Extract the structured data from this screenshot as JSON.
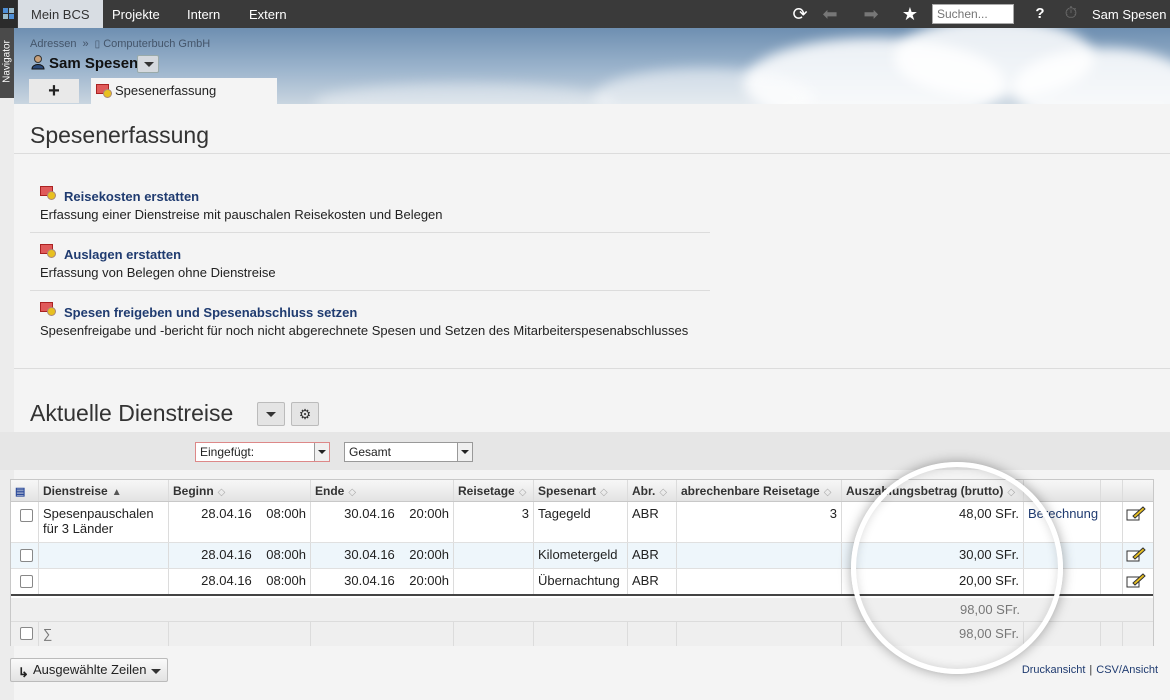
{
  "topnav": {
    "tabs": [
      "Mein BCS",
      "Projekte",
      "Intern",
      "Extern"
    ],
    "search_placeholder": "Suchen...",
    "help_label": "?",
    "user": "Sam Spesen"
  },
  "navigator_label": "Navigator",
  "breadcrumb": {
    "level1": "Adressen",
    "separator": "»",
    "level2": "Computerbuch GmbH"
  },
  "person": {
    "name": "Sam Spesen"
  },
  "tabs": {
    "add_label": "+",
    "current": "Spesenerfassung"
  },
  "page_title": "Spesenerfassung",
  "actions": [
    {
      "title": "Reisekosten erstatten",
      "desc": "Erfassung einer Dienstreise mit pauschalen Reisekosten und Belegen"
    },
    {
      "title": "Auslagen erstatten",
      "desc": "Erfassung von Belegen ohne Dienstreise"
    },
    {
      "title": "Spesen freigeben und Spesenabschluss setzen",
      "desc": "Spesenfreigabe und -bericht für noch nicht abgerechnete Spesen und Setzen des Mitarbeiterspesenabschlusses"
    }
  ],
  "section_title": "Aktuelle Dienstreise",
  "filters": {
    "inserted": "Eingefügt:",
    "scope": "Gesamt"
  },
  "table": {
    "headers": [
      "Dienstreise",
      "Beginn",
      "Ende",
      "Reisetage",
      "Spesenart",
      "Abr.",
      "abrechenbare Reisetage",
      "Auszahlungsbetrag (brutto)"
    ],
    "rows": [
      {
        "trip": "Spesenpauschalen für 3 Länder",
        "begin_date": "28.04.16",
        "begin_time": "08:00h",
        "end_date": "30.04.16",
        "end_time": "20:00h",
        "days": "3",
        "type": "Tagegeld",
        "abr": "ABR",
        "billable_days": "3",
        "amount": "48,00 SFr.",
        "link": "Berechnung"
      },
      {
        "trip": "",
        "begin_date": "28.04.16",
        "begin_time": "08:00h",
        "end_date": "30.04.16",
        "end_time": "20:00h",
        "days": "",
        "type": "Kilometergeld",
        "abr": "ABR",
        "billable_days": "",
        "amount": "30,00 SFr.",
        "link": ""
      },
      {
        "trip": "",
        "begin_date": "28.04.16",
        "begin_time": "08:00h",
        "end_date": "30.04.16",
        "end_time": "20:00h",
        "days": "",
        "type": "Übernachtung",
        "abr": "ABR",
        "billable_days": "",
        "amount": "20,00 SFr.",
        "link": ""
      }
    ],
    "subtotal": "98,00 SFr.",
    "sum_symbol": "∑",
    "total": "98,00 SFr."
  },
  "bottom": {
    "selected_rows": "Ausgewählte Zeilen",
    "print_view": "Druckansicht",
    "separator": "|",
    "csv_view": "CSV/Ansicht"
  },
  "colors": {
    "topbar": "#3a3a3a",
    "link": "#1f3b70",
    "accent_red": "#e05a5a"
  }
}
